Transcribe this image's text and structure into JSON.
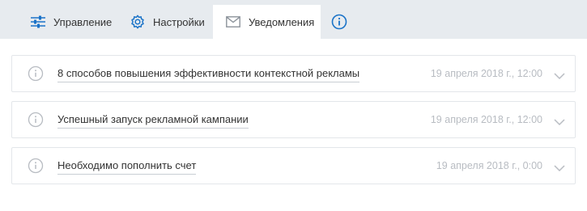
{
  "tabs": [
    {
      "label": "Управление",
      "icon": "sliders-icon"
    },
    {
      "label": "Настройки",
      "icon": "gear-icon"
    },
    {
      "label": "Уведомления",
      "icon": "envelope-icon",
      "active": true
    },
    {
      "label": "",
      "icon": "info-icon"
    }
  ],
  "notifications": [
    {
      "title": "8 способов повышения эффективности контекстной рекламы",
      "date": "19 апреля 2018 г., 12:00"
    },
    {
      "title": "Успешный запуск рекламной кампании",
      "date": "19 апреля 2018 г., 12:00"
    },
    {
      "title": "Необходимо пополнить счет",
      "date": "19 апреля 2018 г., 0:00"
    }
  ],
  "colors": {
    "accent": "#1a73c8",
    "tabbar_bg": "#e7ebef",
    "muted": "#b8bcc2"
  }
}
